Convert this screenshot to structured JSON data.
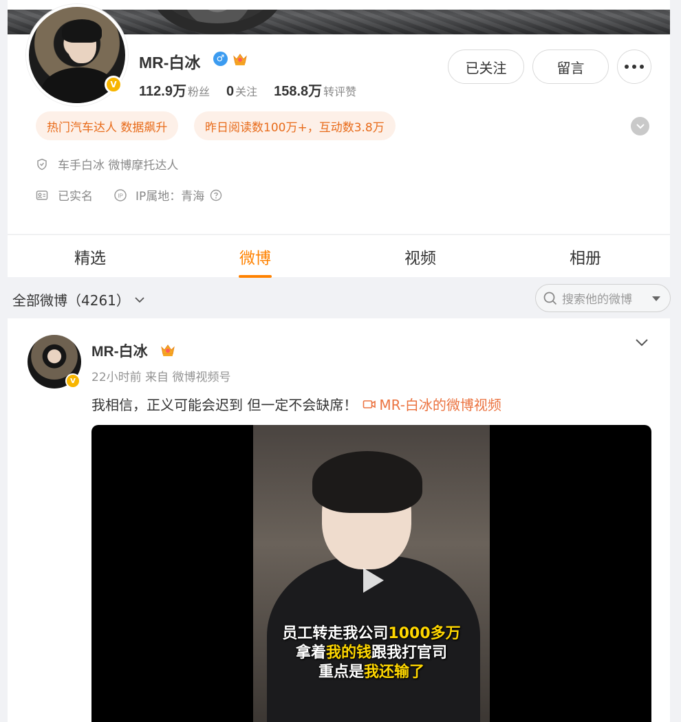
{
  "profile": {
    "username": "MR-白冰",
    "gender_icon": "male-icon",
    "stats": [
      {
        "num": "112.9万",
        "label": "粉丝"
      },
      {
        "num": "0",
        "label": "关注"
      },
      {
        "num": "158.8万",
        "label": "转评赞"
      }
    ],
    "buttons": {
      "follow": "已关注",
      "message": "留言"
    },
    "tags": [
      "热门汽车达人 数据飙升",
      "昨日阅读数100万+，互动数3.8万"
    ],
    "info": {
      "title": "车手白冰 微博摩托达人",
      "verified": "已实名",
      "ip": "IP属地：青海"
    },
    "badge_v": "V"
  },
  "tabs": [
    "精选",
    "微博",
    "视频",
    "相册"
  ],
  "active_tab": "微博",
  "filter": {
    "label": "全部微博（4261）"
  },
  "search": {
    "placeholder": "搜索他的微博"
  },
  "post": {
    "name": "MR-白冰",
    "meta": "22小时前  来自 微博视频号",
    "text": "我相信，正义可能会迟到 但一定不会缺席！",
    "link": "MR-白冰的微博视频",
    "video_subtitles": {
      "line1a": "员工转走我公司",
      "line1b": "1000多万",
      "line2a": "拿着",
      "line2b": "我的钱",
      "line2c": "跟我打官司",
      "line3a": "重点是",
      "line3b": "我还输了"
    }
  },
  "colors": {
    "accent": "#ff8200",
    "link": "#eb7340",
    "tag_text": "#e86b1a",
    "tag_bg": "#fdf0e8"
  }
}
